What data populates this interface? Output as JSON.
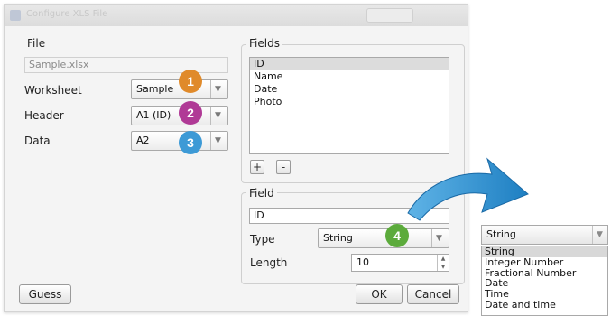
{
  "dialog": {
    "title": "Configure XLS File"
  },
  "file_group": {
    "label": "File",
    "path": "Sample.xlsx",
    "worksheet_label": "Worksheet",
    "worksheet_value": "Sample",
    "header_label": "Header",
    "header_value": "A1 (ID)",
    "data_label": "Data",
    "data_value": "A2"
  },
  "fields_group": {
    "label": "Fields",
    "items": [
      "ID",
      "Name",
      "Date",
      "Photo"
    ],
    "add_label": "+",
    "remove_label": "-"
  },
  "field_group": {
    "label": "Field",
    "name_value": "ID",
    "type_label": "Type",
    "type_value": "String",
    "length_label": "Length",
    "length_value": "10"
  },
  "buttons": {
    "guess": "Guess",
    "ok": "OK",
    "cancel": "Cancel"
  },
  "badges": {
    "b1": {
      "text": "1",
      "color": "#e08a2a"
    },
    "b2": {
      "text": "2",
      "color": "#b03a96"
    },
    "b3": {
      "text": "3",
      "color": "#3d9ad6"
    },
    "b4": {
      "text": "4",
      "color": "#5cab3c"
    }
  },
  "type_dropdown": {
    "selected": "String",
    "options": [
      "String",
      "Integer Number",
      "Fractional Number",
      "Date",
      "Time",
      "Date and time"
    ]
  },
  "arrow_color": "#2a8fd0"
}
